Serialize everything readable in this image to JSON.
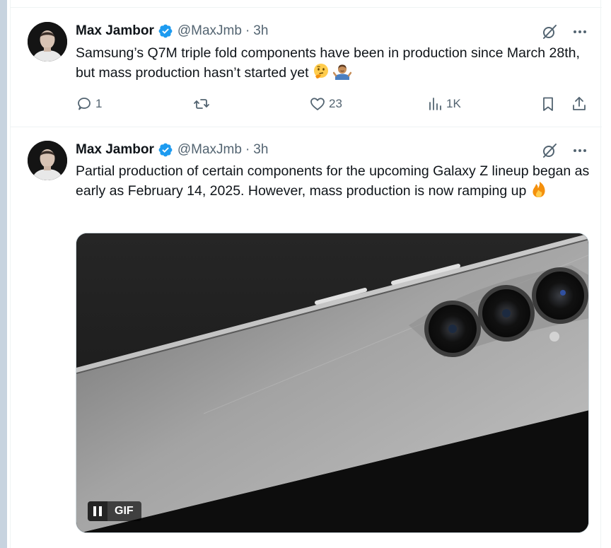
{
  "colors": {
    "verified": "#1d9bf0",
    "secondary_text": "#536471",
    "primary_text": "#0f1419",
    "divider": "#eff3f4"
  },
  "tweets": [
    {
      "author": {
        "name": "Max Jambor",
        "handle": "@MaxJmb",
        "verified": true
      },
      "time": "3h",
      "separator": "·",
      "text": "Samsung’s Q7M triple fold components have been in production since March 28th, but mass production hasn’t started yet",
      "emojis": [
        "thinking-face-emoji",
        "person-shrugging-emoji"
      ],
      "stats": {
        "replies": "1",
        "reposts": "",
        "likes": "23",
        "views": "1K"
      }
    },
    {
      "author": {
        "name": "Max Jambor",
        "handle": "@MaxJmb",
        "verified": true
      },
      "time": "3h",
      "separator": "·",
      "text": "Partial production of certain components for the upcoming Galaxy Z lineup began as early as February 14, 2025. However, mass production is now ramping up",
      "emojis": [
        "fire-emoji"
      ],
      "media": {
        "type": "gif",
        "badge_label": "GIF",
        "playing": true
      }
    }
  ],
  "icons": {
    "grok": "grok-icon",
    "more": "more-icon",
    "reply": "reply-icon",
    "repost": "repost-icon",
    "like": "heart-icon",
    "views": "views-icon",
    "bookmark": "bookmark-icon",
    "share": "share-icon"
  }
}
